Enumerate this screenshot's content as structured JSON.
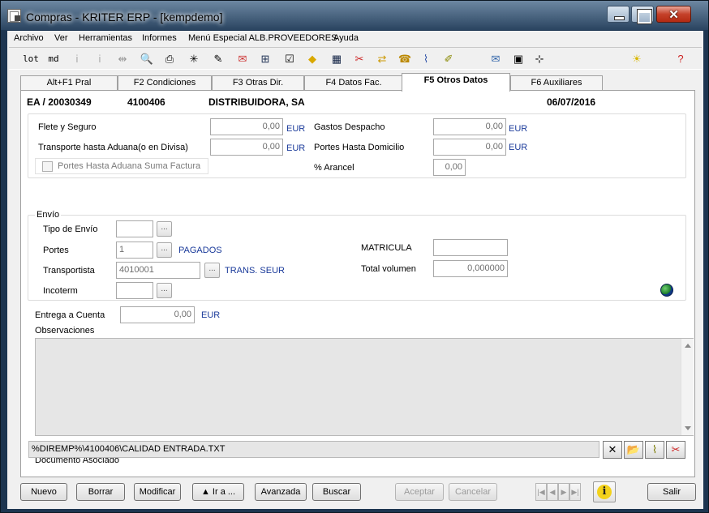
{
  "window": {
    "title": "Compras - KRITER ERP - [kempdemo]"
  },
  "menu": [
    "Archivo",
    "Ver",
    "Herramientas",
    "Informes",
    "Menú Especial ALB.PROVEEDORES",
    "Ayuda"
  ],
  "toolbar": {
    "lot_label": "lot",
    "md_label": "md"
  },
  "tabs": [
    "Alt+F1 Pral",
    "F2 Condiciones",
    "F3 Otras Dir.",
    "F4 Datos Fac.",
    "F5 Otros Datos",
    "F6 Auxiliares"
  ],
  "header": {
    "doc": "EA / 20030349",
    "code": "4100406",
    "supplier": "DISTRIBUIDORA, SA",
    "date": "06/07/2016"
  },
  "costs": {
    "flete_label": "Flete y Seguro",
    "flete_value": "0,00",
    "flete_unit": "EUR",
    "transporte_label": "Transporte hasta Aduana(o en Divisa)",
    "transporte_value": "0,00",
    "transporte_unit": "EUR",
    "portes_check_label": "Portes Hasta Aduana Suma Factura",
    "gastos_label": "Gastos Despacho",
    "gastos_value": "0,00",
    "gastos_unit": "EUR",
    "portes_dom_label": "Portes Hasta Domicilio",
    "portes_dom_value": "0,00",
    "portes_dom_unit": "EUR",
    "arancel_label": "% Arancel",
    "arancel_value": "0,00"
  },
  "envio": {
    "legend": "Envío",
    "tipo_label": "Tipo de Envío",
    "tipo_value": "",
    "portes_label": "Portes",
    "portes_value": "1",
    "portes_desc": "PAGADOS",
    "transportista_label": "Transportista",
    "transportista_value": "4010001",
    "transportista_desc": "TRANS. SEUR",
    "incoterm_label": "Incoterm",
    "incoterm_value": "",
    "matricula_label": "MATRICULA",
    "matricula_value": "",
    "volumen_label": "Total volumen",
    "volumen_value": "0,000000",
    "dots_label": "..."
  },
  "entrega": {
    "label": "Entrega a Cuenta",
    "value": "0,00",
    "unit": "EUR"
  },
  "observaciones": {
    "label": "Observaciones",
    "value": ""
  },
  "documento": {
    "label": "Documento Asociado",
    "value": "%DIREMP%\\4100406\\CALIDAD ENTRADA.TXT"
  },
  "buttons": {
    "nuevo": "Nuevo",
    "borrar": "Borrar",
    "modificar": "Modificar",
    "ir_a": "▲ Ir a ...",
    "avanzada": "Avanzada",
    "buscar": "Buscar",
    "aceptar": "Aceptar",
    "cancelar": "Cancelar",
    "salir": "Salir"
  }
}
